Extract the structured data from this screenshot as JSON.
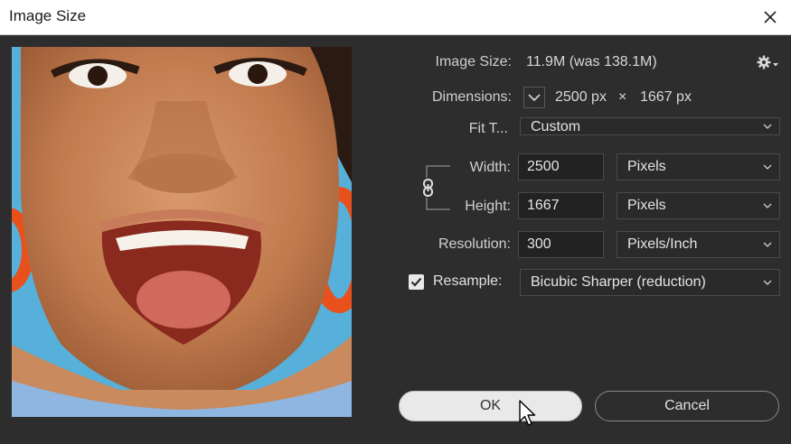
{
  "window": {
    "title": "Image Size"
  },
  "info": {
    "image_size_label": "Image Size:",
    "image_size_value": "11.9M (was 138.1M)",
    "dimensions_label": "Dimensions:",
    "dimensions_width": "2500 px",
    "dimensions_separator": "×",
    "dimensions_height": "1667 px"
  },
  "fit_to": {
    "label": "Fit T...",
    "selected": "Custom"
  },
  "width": {
    "label": "Width:",
    "value": "2500",
    "unit": "Pixels"
  },
  "height": {
    "label": "Height:",
    "value": "1667",
    "unit": "Pixels"
  },
  "resolution": {
    "label": "Resolution:",
    "value": "300",
    "unit": "Pixels/Inch"
  },
  "resample": {
    "label": "Resample:",
    "checked": true,
    "method": "Bicubic Sharper (reduction)"
  },
  "buttons": {
    "ok": "OK",
    "cancel": "Cancel"
  },
  "icons": {
    "close": "close-icon",
    "settings": "gear-icon",
    "dimensions_toggle": "chevron-down-icon",
    "constrain": "chain-link-icon",
    "checkbox": "checkmark-icon",
    "cursor": "mouse-pointer-icon"
  },
  "colors": {
    "dialog_bg": "#2d2d2d",
    "titlebar_bg": "#ffffff",
    "field_bg": "#222222",
    "ok_bg": "#e9e9e9"
  }
}
